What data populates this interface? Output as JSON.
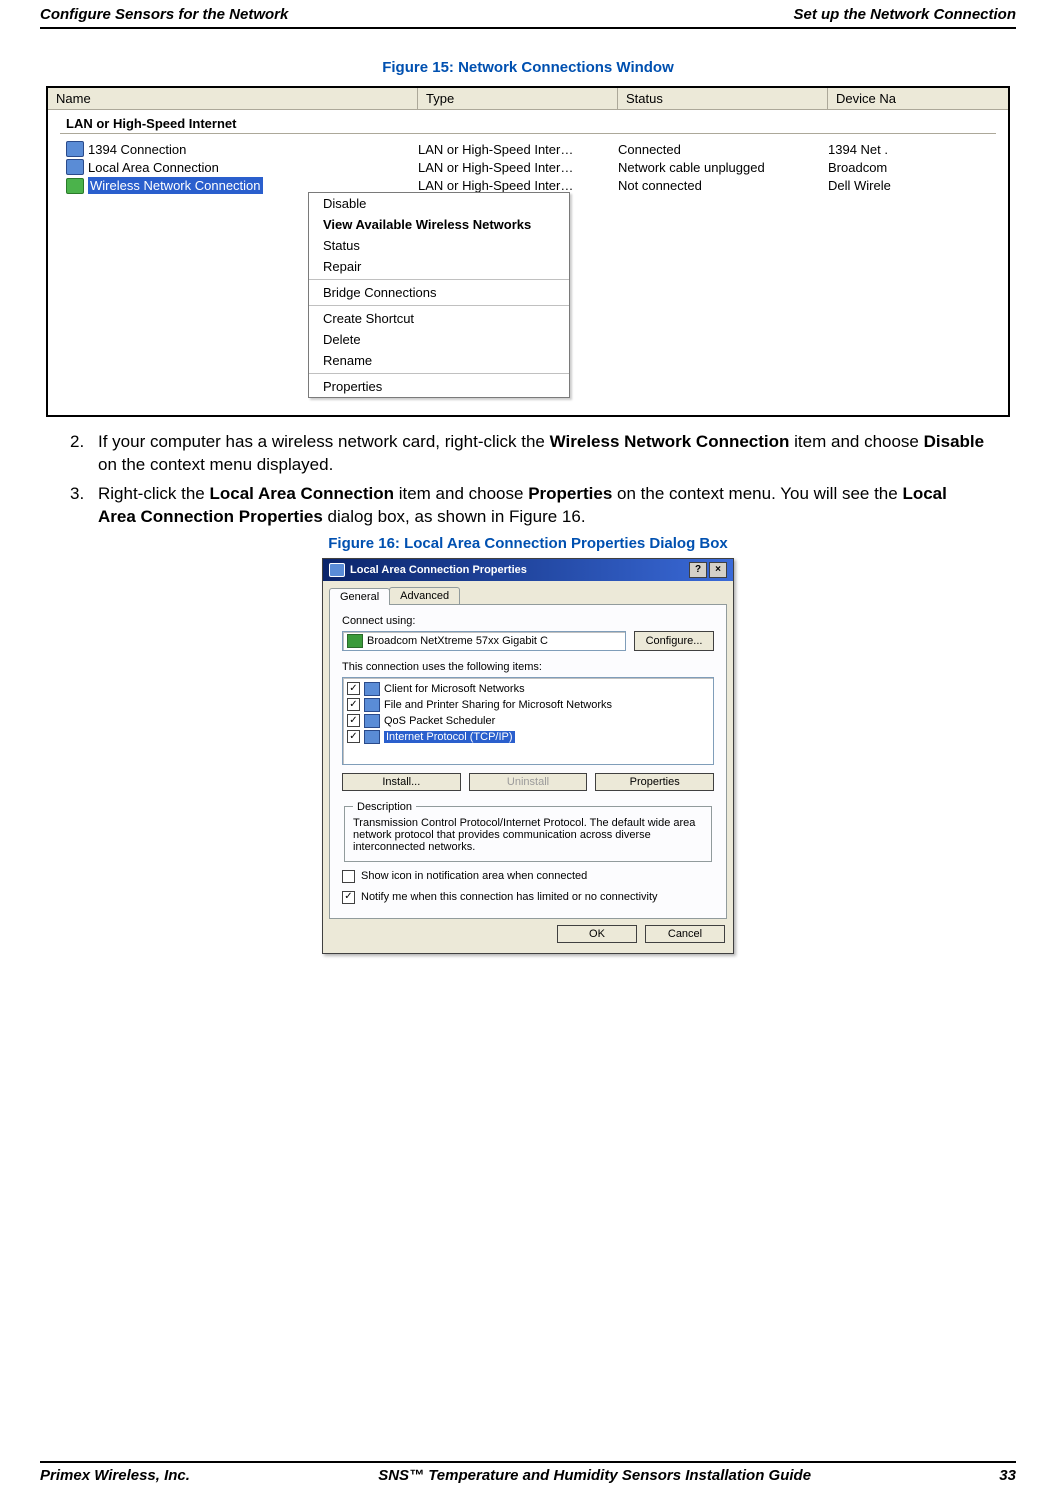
{
  "header": {
    "left": "Configure Sensors for the Network",
    "right": "Set up the Network Connection"
  },
  "figure15": {
    "caption": "Figure 15: Network Connections Window",
    "columns": {
      "name": "Name",
      "type": "Type",
      "status": "Status",
      "device": "Device Na"
    },
    "group": "LAN or High-Speed Internet",
    "rows": [
      {
        "name": "1394 Connection",
        "type": "LAN or High-Speed Inter…",
        "status": "Connected",
        "device": "1394 Net ."
      },
      {
        "name": "Local Area Connection",
        "type": "LAN or High-Speed Inter…",
        "status": "Network cable unplugged",
        "device": "Broadcom"
      },
      {
        "name": "Wireless Network Connection",
        "type": "LAN or High-Speed Inter…",
        "status": "Not connected",
        "device": "Dell Wirele"
      }
    ],
    "menu": {
      "disable": "Disable",
      "view": "View Available Wireless Networks",
      "status": "Status",
      "repair": "Repair",
      "bridge": "Bridge Connections",
      "shortcut": "Create Shortcut",
      "delete": "Delete",
      "rename": "Rename",
      "properties": "Properties"
    }
  },
  "steps": {
    "s2_pre": "If your computer has a wireless network card, right-click the ",
    "s2_bold1": "Wireless Network Connection",
    "s2_mid": " item and choose ",
    "s2_bold2": "Disable",
    "s2_post": " on the context menu displayed.",
    "s3_pre": "Right-click the ",
    "s3_bold1": "Local Area Connection",
    "s3_mid1": " item and choose ",
    "s3_bold2": "Properties",
    "s3_mid2": " on the context menu. You will see the ",
    "s3_bold3": "Local Area Connection Properties",
    "s3_post": " dialog box, as shown in Figure 16."
  },
  "figure16": {
    "caption": "Figure 16: Local Area Connection Properties Dialog Box",
    "title": "Local Area Connection Properties",
    "tab_general": "General",
    "tab_advanced": "Advanced",
    "connect_using": "Connect using:",
    "adapter": "Broadcom NetXtreme 57xx Gigabit C",
    "configure": "Configure...",
    "uses_items": "This connection uses the following items:",
    "items": [
      "Client for Microsoft Networks",
      "File and Printer Sharing for Microsoft Networks",
      "QoS Packet Scheduler",
      "Internet Protocol (TCP/IP)"
    ],
    "install": "Install...",
    "uninstall": "Uninstall",
    "properties": "Properties",
    "desc_legend": "Description",
    "desc_text": "Transmission Control Protocol/Internet Protocol. The default wide area network protocol that provides communication across diverse interconnected networks.",
    "show_icon": "Show icon in notification area when connected",
    "notify": "Notify me when this connection has limited or no connectivity",
    "ok": "OK",
    "cancel": "Cancel"
  },
  "footer": {
    "left": "Primex Wireless, Inc.",
    "center": "SNS™ Temperature and Humidity Sensors Installation Guide",
    "right": "33"
  }
}
